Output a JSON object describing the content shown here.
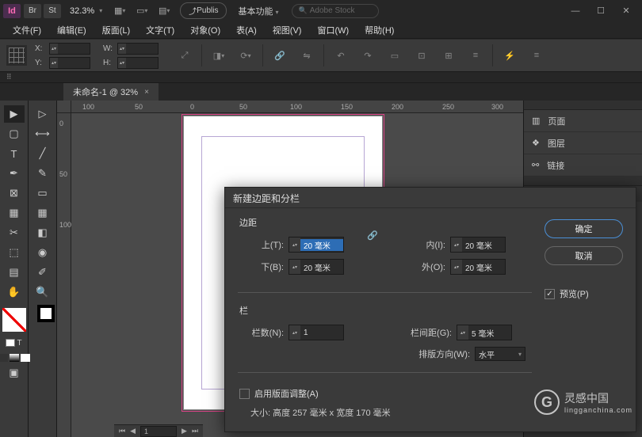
{
  "titlebar": {
    "app": "Id",
    "br": "Br",
    "st": "St",
    "zoom": "32.3%",
    "publish": "Publis",
    "workspace": "基本功能",
    "search_placeholder": "Adobe Stock"
  },
  "menus": [
    "文件(F)",
    "编辑(E)",
    "版面(L)",
    "文字(T)",
    "对象(O)",
    "表(A)",
    "视图(V)",
    "窗口(W)",
    "帮助(H)"
  ],
  "options": {
    "x": "X:",
    "y": "Y:",
    "w": "W:",
    "h": "H:"
  },
  "doctab": {
    "name": "未命名-1 @ 32%"
  },
  "ruler_h": [
    "100",
    "50",
    "0",
    "50",
    "100",
    "150",
    "200",
    "250",
    "300"
  ],
  "ruler_v": [
    "0",
    "50",
    "100"
  ],
  "panels": {
    "pages": "页面",
    "layers": "图层",
    "links": "链接"
  },
  "dialog": {
    "title": "新建边距和分栏",
    "margins_label": "边距",
    "top_l": "上(T):",
    "bottom_l": "下(B):",
    "inside_l": "内(I):",
    "outside_l": "外(O):",
    "top_v": "20 毫米",
    "bottom_v": "20 毫米",
    "inside_v": "20 毫米",
    "outside_v": "20 毫米",
    "cols_label": "栏",
    "count_l": "栏数(N):",
    "count_v": "1",
    "gutter_l": "栏间距(G):",
    "gutter_v": "5 毫米",
    "dir_l": "排版方向(W):",
    "dir_v": "水平",
    "ok": "确定",
    "cancel": "取消",
    "preview": "预览(P)",
    "layout_adj": "启用版面调整(A)",
    "size": "大小: 高度 257 毫米 x 宽度 170 毫米"
  },
  "status": {
    "page": "1"
  },
  "watermark": {
    "main": "灵感中国",
    "sub": "lingganchina.com"
  }
}
